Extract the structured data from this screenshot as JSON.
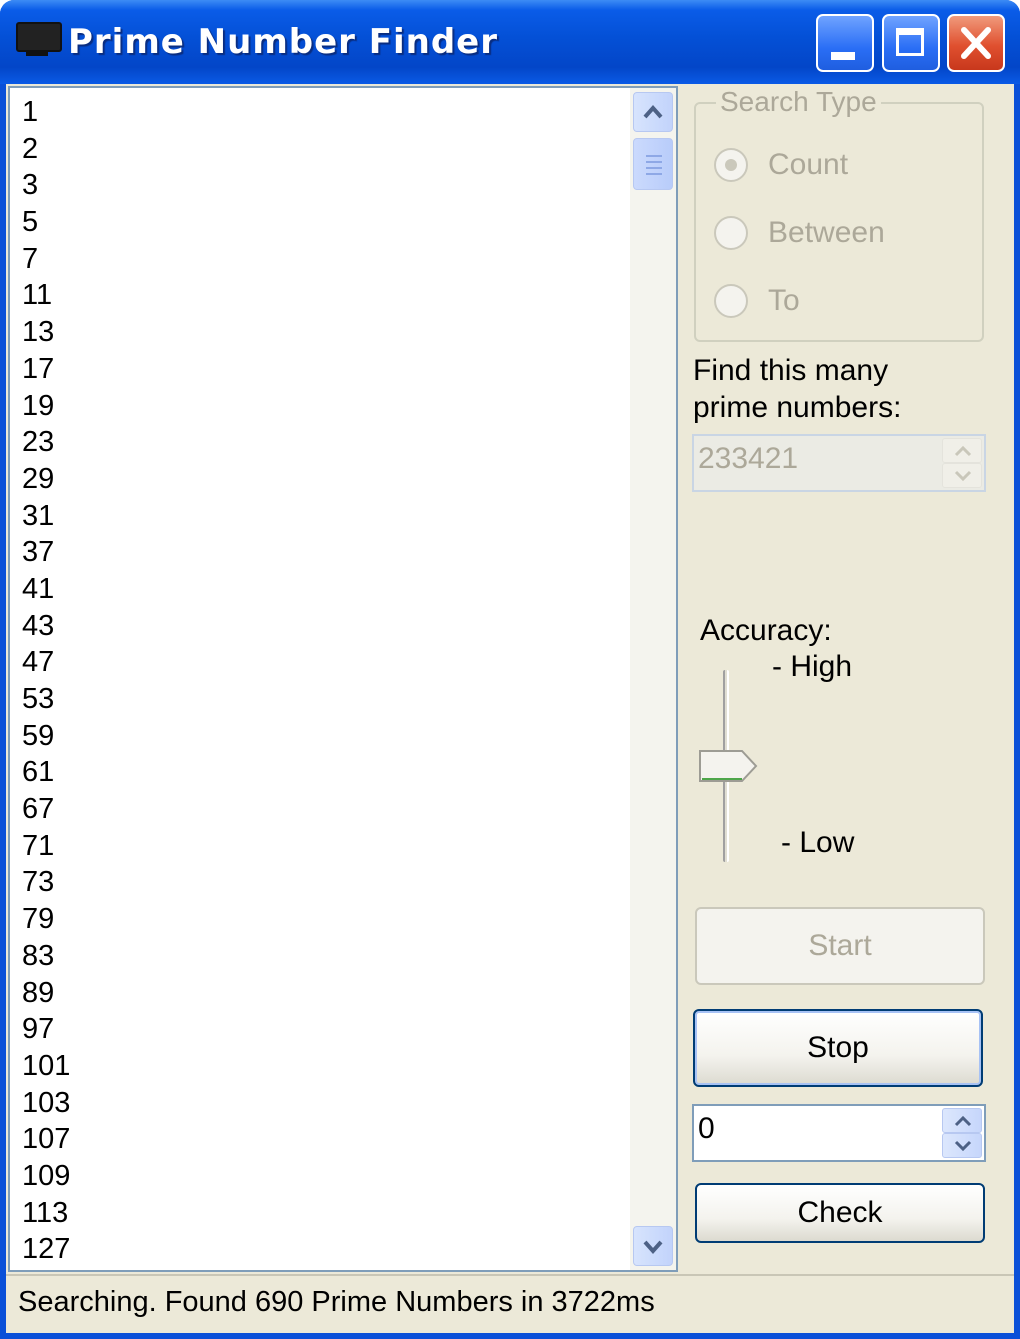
{
  "window": {
    "title": "Prime Number Finder",
    "controls": {
      "minimize": "minimize-icon",
      "maximize": "maximize-icon",
      "close": "close-icon"
    },
    "accent_color": "#0a50d8",
    "close_color": "#e0502f"
  },
  "primes_list": [
    "1",
    "2",
    "3",
    "5",
    "7",
    "11",
    "13",
    "17",
    "19",
    "23",
    "29",
    "31",
    "37",
    "41",
    "43",
    "47",
    "53",
    "59",
    "61",
    "67",
    "71",
    "73",
    "79",
    "83",
    "89",
    "97",
    "101",
    "103",
    "107",
    "109",
    "113",
    "127"
  ],
  "search_type": {
    "legend": "Search Type",
    "options": [
      {
        "label": "Count",
        "selected": true,
        "enabled": false
      },
      {
        "label": "Between",
        "selected": false,
        "enabled": false
      },
      {
        "label": "To",
        "selected": false,
        "enabled": false
      }
    ]
  },
  "count_field": {
    "label_line1": "Find this many",
    "label_line2": "prime numbers:",
    "value": "233421",
    "enabled": false
  },
  "accuracy": {
    "label": "Accuracy:",
    "high_label": "- High",
    "low_label": "- Low",
    "level_fraction": 0.5
  },
  "buttons": {
    "start": "Start",
    "stop": "Stop",
    "check": "Check"
  },
  "check_field": {
    "value": "0"
  },
  "status": {
    "text": "Searching. Found 690 Prime Numbers in 3722ms"
  }
}
